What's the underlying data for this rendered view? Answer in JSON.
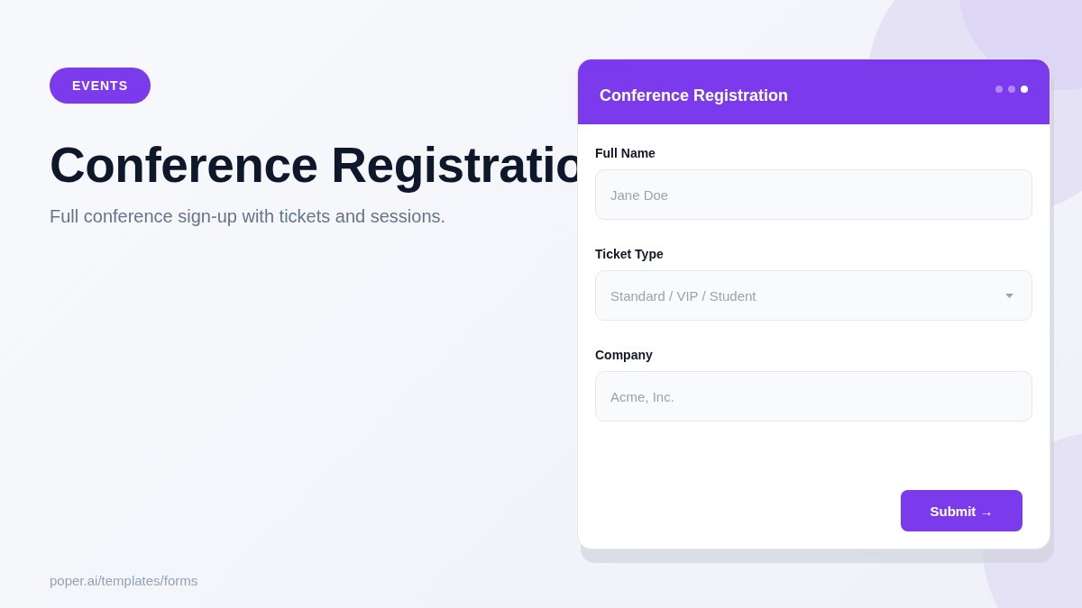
{
  "hero": {
    "badge": "EVENTS",
    "title": "Conference Registratio",
    "subtitle": "Full conference sign-up with tickets and sessions.",
    "footer": "poper.ai/templates/forms"
  },
  "form": {
    "title": "Conference Registration",
    "steps": [
      {
        "selected": false
      },
      {
        "selected": false
      },
      {
        "selected": true
      }
    ],
    "fields": [
      {
        "kind": "text",
        "label": "Full Name",
        "placeholder": "Jane Doe"
      },
      {
        "kind": "select",
        "label": "Ticket Type",
        "placeholder": "Standard / VIP / Student"
      },
      {
        "kind": "text",
        "label": "Company",
        "placeholder": "Acme, Inc."
      }
    ],
    "submit": "Submit →"
  }
}
